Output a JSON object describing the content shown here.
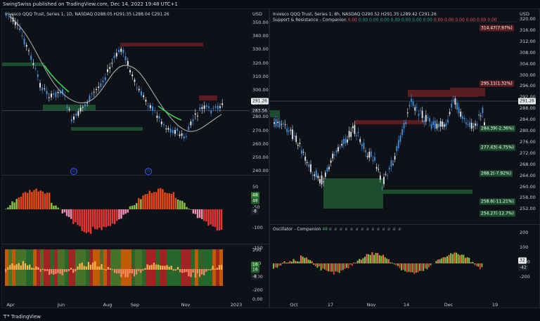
{
  "header": {
    "text": "SwingSwiss published on TradingView.com, Dec 14, 2022 19:48 UTC+1"
  },
  "footer": {
    "brand": "TradingView"
  },
  "left": {
    "legend": {
      "symbol": "Invesco QQQ Trust, Series 1, 1D, NASDAQ",
      "o": "O288.05",
      "h": "H291.35",
      "l": "L288.04",
      "c": "C291.26"
    },
    "price_axis": {
      "unit": "USD",
      "ticks": [
        "350.00",
        "340.00",
        "330.00",
        "320.00",
        "310.00",
        "300.00",
        "290.00",
        "280.00",
        "270.00",
        "260.00",
        "250.00",
        "240.00"
      ],
      "last": "291.26",
      "ma": "283.56"
    },
    "osc1_axis": {
      "ticks": [
        "50",
        "-50",
        "-100",
        "-150"
      ],
      "tags": [
        "48",
        "48",
        "-8"
      ]
    },
    "osc2_axis": {
      "ticks": [
        "200",
        "100",
        "-100",
        "-200"
      ],
      "tags": [
        "16",
        "16",
        "-8"
      ],
      "zero": "0.00"
    },
    "time_axis": [
      "Apr",
      "Jun",
      "Aug",
      "Sep",
      "Nov",
      "2023"
    ],
    "markers": [
      "D",
      "D"
    ]
  },
  "right": {
    "legend": {
      "symbol": "Invesco QQQ Trust, Series 1, 8h, NASDAQ",
      "o": "O290.52",
      "h": "H291.35",
      "l": "L289.42",
      "c": "C291.26"
    },
    "indicator": {
      "name": "Support & Resistance - Companion",
      "values": [
        "0.00",
        "0.00",
        "0.00",
        "0.00",
        "0.00",
        "0.00",
        "0.00",
        "0.00",
        "0.00",
        "0.00",
        "0.00",
        "0.00",
        "0.00",
        "0.00"
      ]
    },
    "price_axis": {
      "unit": "USD",
      "ticks": [
        "320.00",
        "316.00",
        "312.00",
        "308.00",
        "304.00",
        "300.00",
        "296.00",
        "292.00",
        "288.00",
        "284.00",
        "280.00",
        "276.00",
        "272.00",
        "268.00",
        "264.00",
        "260.00",
        "256.00",
        "252.00"
      ],
      "last": "291.26"
    },
    "levels": [
      {
        "label": "314.47(7.97%)",
        "kind": "res"
      },
      {
        "label": "295.11(1.32%)",
        "kind": "res"
      },
      {
        "label": "284.39(-2.36%)",
        "kind": "sup"
      },
      {
        "label": "277.43(-4.75%)",
        "kind": "sup"
      },
      {
        "label": "268.2(-7.92%)",
        "kind": "sup"
      },
      {
        "label": "258.6(-11.21%)",
        "kind": "sup"
      },
      {
        "label": "254.27(-12.7%)",
        "kind": "sup"
      }
    ],
    "osc": {
      "name": "Oscillator - Companion",
      "value": "48",
      "ticks": [
        "200",
        "100",
        "-100",
        "-200"
      ],
      "tags": [
        "32",
        "-42"
      ]
    },
    "time_axis": [
      "Oct",
      "17",
      "Nov",
      "14",
      "Dec",
      "19"
    ]
  },
  "colors": {
    "up": "#26a69a",
    "down": "#ef5350",
    "support": "#1b4d2e",
    "resistance": "#5a1d22",
    "ma": "#9e9e9e"
  }
}
